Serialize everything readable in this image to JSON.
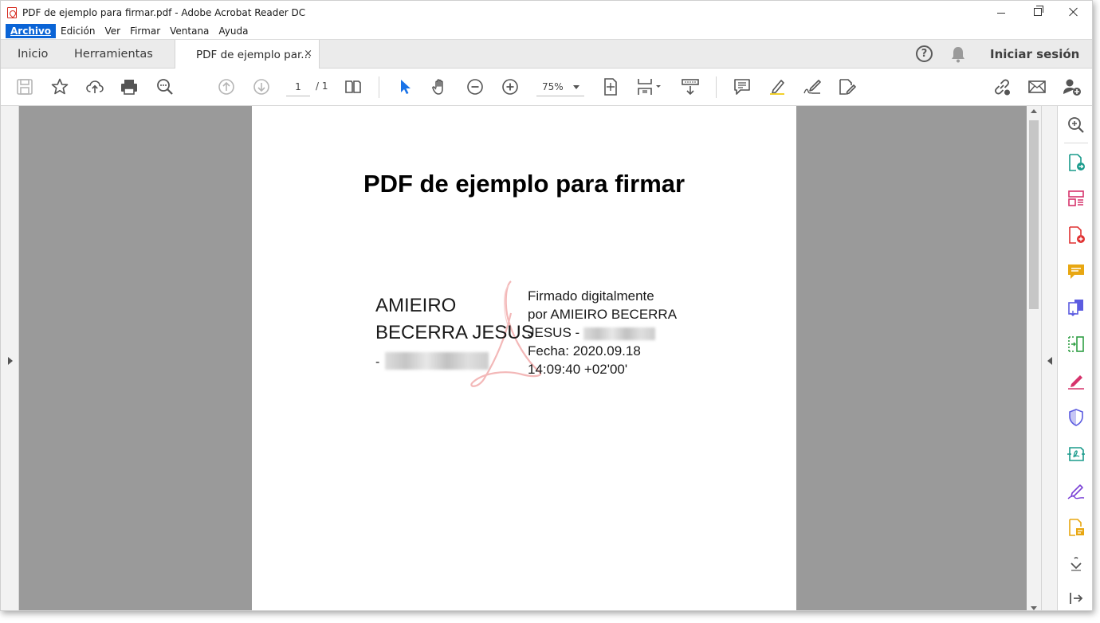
{
  "window": {
    "title": "PDF de ejemplo para firmar.pdf - Adobe Acrobat Reader DC"
  },
  "menu": {
    "items": [
      "Archivo",
      "Edición",
      "Ver",
      "Firmar",
      "Ventana",
      "Ayuda"
    ]
  },
  "tabs": {
    "home": "Inicio",
    "tools": "Herramientas",
    "document": "PDF de ejemplo par...",
    "close": "×"
  },
  "header": {
    "help": "?",
    "sign_in": "Iniciar sesión"
  },
  "toolbar": {
    "page_current": "1",
    "page_total": "/  1",
    "zoom": "75%"
  },
  "document": {
    "title": "PDF de ejemplo para firmar",
    "signer_line1": "AMIEIRO",
    "signer_line2": "BECERRA JESUS",
    "signer_line3": "-",
    "details": [
      "Firmado digitalmente",
      "por AMIEIRO BECERRA",
      "JESUS -",
      "Fecha: 2020.09.18",
      "14:09:40 +02'00'"
    ]
  },
  "colors": {
    "accent": "#0a64d6",
    "acrobat_red": "#d4271c"
  }
}
